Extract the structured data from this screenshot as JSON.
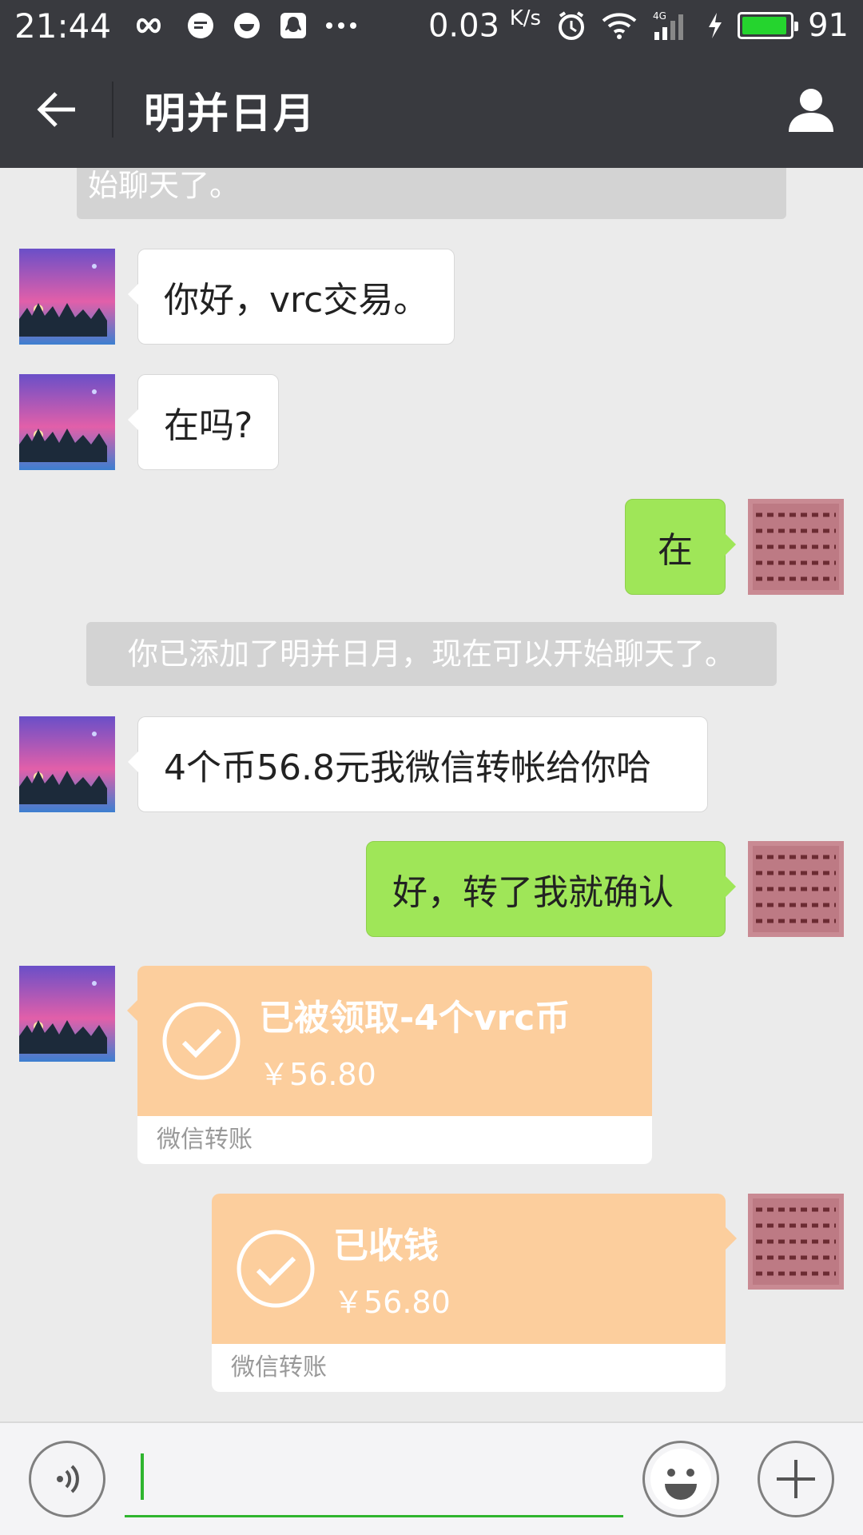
{
  "status_bar": {
    "time": "21:44",
    "network_speed": "0.03",
    "network_speed_unit": "K/s",
    "network_type": "4G",
    "battery": "91",
    "icons": [
      "infinity-icon",
      "chat-icon",
      "smile-app-icon",
      "qq-icon",
      "more-dots-icon",
      "alarm-icon",
      "wifi-icon",
      "signal-icon",
      "charging-icon",
      "battery-icon"
    ]
  },
  "nav": {
    "title": "明并日月",
    "back_icon": "back-arrow-icon",
    "profile_icon": "person-icon"
  },
  "chat": {
    "system_top_partial": "始聊天了。",
    "messages": [
      {
        "side": "in",
        "text": "你好，vrc交易。"
      },
      {
        "side": "in",
        "text": "在吗?"
      },
      {
        "side": "out",
        "text": "在"
      },
      {
        "side": "system",
        "text": "你已添加了明并日月，现在可以开始聊天了。"
      },
      {
        "side": "in",
        "text": "4个币56.8元我微信转帐给你哈"
      },
      {
        "side": "out",
        "text": "好，转了我就确认"
      }
    ],
    "transfers": [
      {
        "side": "in",
        "title": "已被领取-4个vrc币",
        "amount": "￥56.80",
        "footer": "微信转账"
      },
      {
        "side": "out",
        "title": "已收钱",
        "amount": "￥56.80",
        "footer": "微信转账"
      }
    ]
  },
  "input_bar": {
    "voice_icon": "voice-icon",
    "emoji_icon": "emoji-icon",
    "plus_icon": "plus-icon"
  },
  "colors": {
    "header": "#393a3f",
    "bubble_out": "#9fe658",
    "transfer": "#fcce9d",
    "chat_bg": "#ebebeb"
  }
}
